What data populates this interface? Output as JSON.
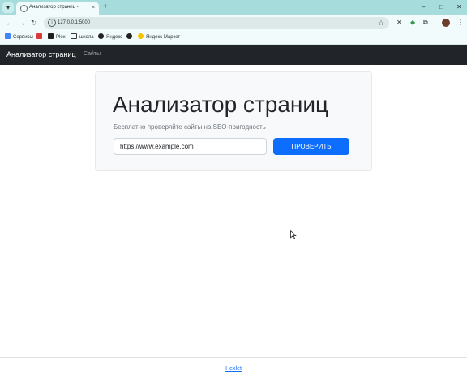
{
  "browser": {
    "tab_title": "Анализатор страниц -",
    "tab_close": "×",
    "new_tab": "+",
    "url": "127.0.0.1:5000",
    "window_controls": {
      "minimize": "–",
      "maximize": "□",
      "close": "✕"
    },
    "bookmarks": [
      {
        "label": "Сервисы",
        "icon": "apps-grid-icon",
        "color": "#4285f4"
      },
      {
        "label": "",
        "icon": "media-icon",
        "color": "#d83a3a"
      },
      {
        "label": "Plex",
        "icon": "plex-icon",
        "color": "#1f1f1f"
      },
      {
        "label": "школа",
        "icon": "folder-icon",
        "color": "#3a3a3a"
      },
      {
        "label": "Яндекс",
        "icon": "globe-icon",
        "color": "#222222"
      },
      {
        "label": "",
        "icon": "globe-icon",
        "color": "#222222"
      },
      {
        "label": "Яндекс Маркет",
        "icon": "market-icon",
        "color": "#f5c400"
      }
    ]
  },
  "navbar": {
    "brand": "Анализатор страниц",
    "link": "Сайты"
  },
  "hero": {
    "title": "Анализатор страниц",
    "lead": "Бесплатно проверяйте сайты на SEO-пригодность",
    "input_value": "https://www.example.com",
    "button_label": "ПРОВЕРИТЬ"
  },
  "footer": {
    "link": "Hexlet"
  },
  "colors": {
    "navbar_bg": "#212529",
    "primary": "#0d6efd",
    "hero_bg": "#f8f9fa",
    "browser_tabbar": "#a6dddc"
  }
}
